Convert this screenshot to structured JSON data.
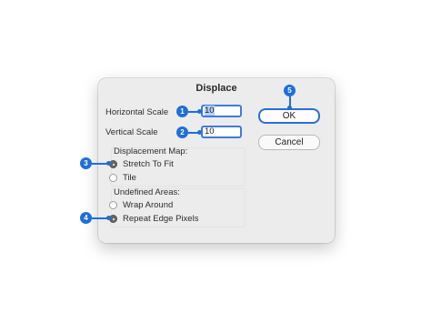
{
  "dialog": {
    "title": "Displace",
    "horizontal_scale": {
      "label": "Horizontal Scale",
      "value": "10"
    },
    "vertical_scale": {
      "label": "Vertical Scale",
      "value": "10"
    },
    "displacement_map": {
      "label": "Displacement Map:",
      "options": [
        {
          "label": "Stretch To Fit",
          "selected": true
        },
        {
          "label": "Tile",
          "selected": false
        }
      ]
    },
    "undefined_areas": {
      "label": "Undefined Areas:",
      "options": [
        {
          "label": "Wrap Around",
          "selected": false
        },
        {
          "label": "Repeat Edge Pixels",
          "selected": true
        }
      ]
    },
    "ok_label": "OK",
    "cancel_label": "Cancel"
  },
  "callouts": {
    "c1": "1",
    "c2": "2",
    "c3": "3",
    "c4": "4",
    "c5": "5"
  },
  "colors": {
    "accent": "#1e6fd9",
    "field_border": "#3d7be0",
    "dialog_bg": "#ececec"
  }
}
